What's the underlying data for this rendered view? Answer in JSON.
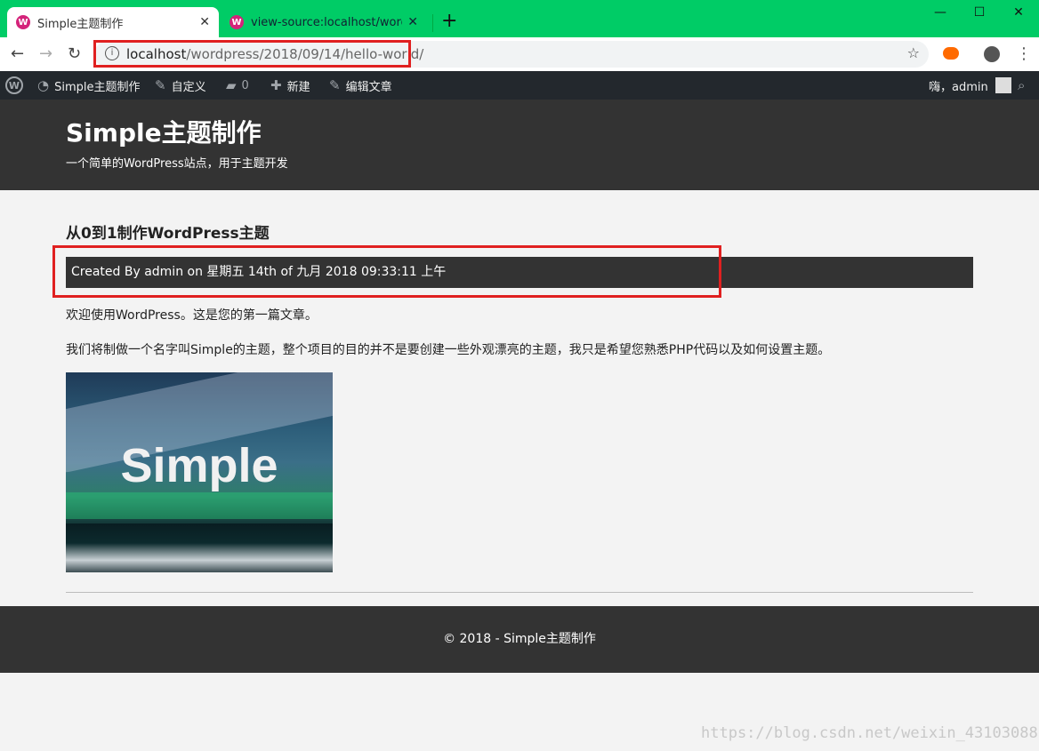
{
  "browser": {
    "tabs": [
      {
        "label": "Simple主题制作",
        "active": true
      },
      {
        "label": "view-source:localhost/wordpress",
        "active": false
      }
    ],
    "new_tab": "+",
    "window_controls": {
      "minimize": "—",
      "maximize": "☐",
      "close": "✕"
    },
    "url_host": "localhost",
    "url_path": "/wordpress/2018/09/14/hello-world/"
  },
  "admin_bar": {
    "site_name": "Simple主题制作",
    "customize": "自定义",
    "comments_count": "0",
    "new": "新建",
    "edit_post": "编辑文章",
    "greeting": "嗨，admin"
  },
  "site": {
    "title": "Simple主题制作",
    "description": "一个简单的WordPress站点，用于主题开发"
  },
  "post": {
    "title": "从0到1制作WordPress主题",
    "meta": "Created By admin on 星期五 14th of 九月 2018 09:33:11 上午",
    "paragraphs": [
      "欢迎使用WordPress。这是您的第一篇文章。",
      "我们将制做一个名字叫Simple的主题，整个项目的目的并不是要创建一些外观漂亮的主题，我只是希望您熟悉PHP代码以及如何设置主题。"
    ],
    "image_text": "Simple"
  },
  "footer": {
    "text": "© 2018 - Simple主题制作"
  },
  "watermark": "https://blog.csdn.net/weixin_43103088",
  "colors": {
    "tabstrip": "#00cc66",
    "admin_bar": "#23282d",
    "header": "#333333",
    "highlight": "#e02020"
  }
}
